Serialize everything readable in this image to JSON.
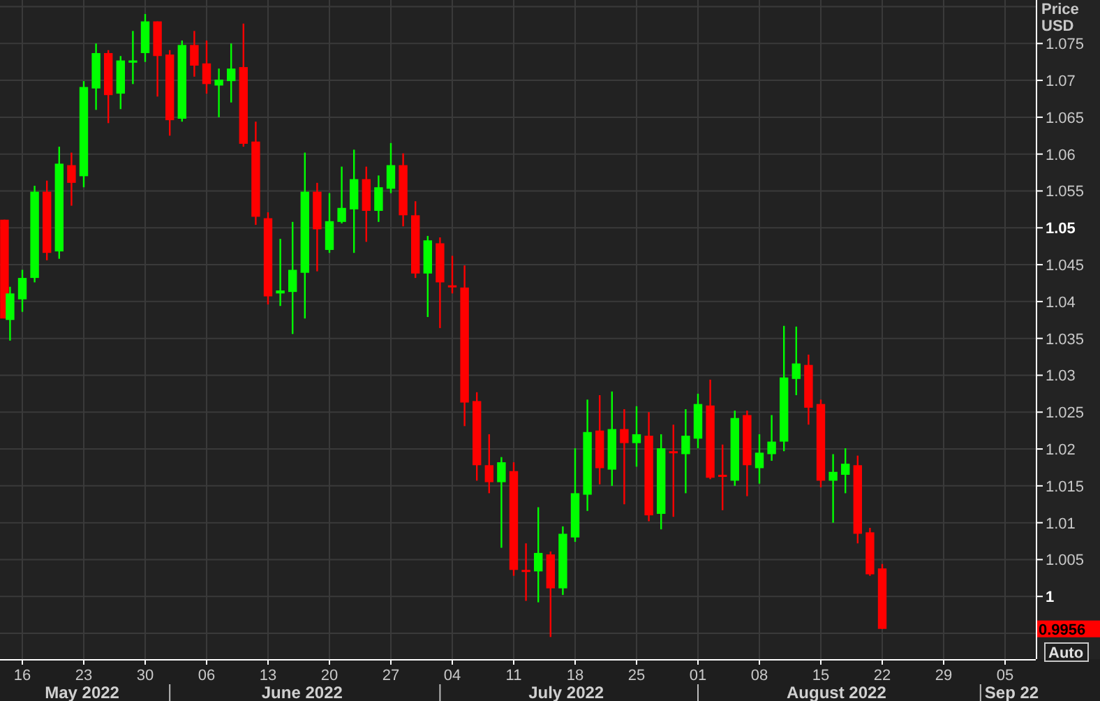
{
  "chart": {
    "axis_header": [
      "Price",
      "USD"
    ],
    "price_ticks": [
      {
        "label": "1.075",
        "bold": false
      },
      {
        "label": "1.07",
        "bold": false
      },
      {
        "label": "1.065",
        "bold": false
      },
      {
        "label": "1.06",
        "bold": false
      },
      {
        "label": "1.055",
        "bold": false
      },
      {
        "label": "1.05",
        "bold": true
      },
      {
        "label": "1.045",
        "bold": false
      },
      {
        "label": "1.04",
        "bold": false
      },
      {
        "label": "1.035",
        "bold": false
      },
      {
        "label": "1.03",
        "bold": false
      },
      {
        "label": "1.025",
        "bold": false
      },
      {
        "label": "1.02",
        "bold": false
      },
      {
        "label": "1.015",
        "bold": false
      },
      {
        "label": "1.01",
        "bold": false
      },
      {
        "label": "1.005",
        "bold": false
      },
      {
        "label": "1",
        "bold": true
      }
    ],
    "last_price": {
      "label": "0.9956"
    },
    "auto_button": {
      "label": "Auto"
    },
    "date_ticks": [
      "16",
      "23",
      "30",
      "06",
      "13",
      "20",
      "27",
      "04",
      "11",
      "18",
      "25",
      "01",
      "08",
      "15",
      "22",
      "29",
      "05"
    ],
    "months": [
      {
        "label": "May 2022"
      },
      {
        "label": "June 2022"
      },
      {
        "label": "July 2022"
      },
      {
        "label": "August 2022"
      },
      {
        "label": "Sep 22"
      }
    ]
  }
}
